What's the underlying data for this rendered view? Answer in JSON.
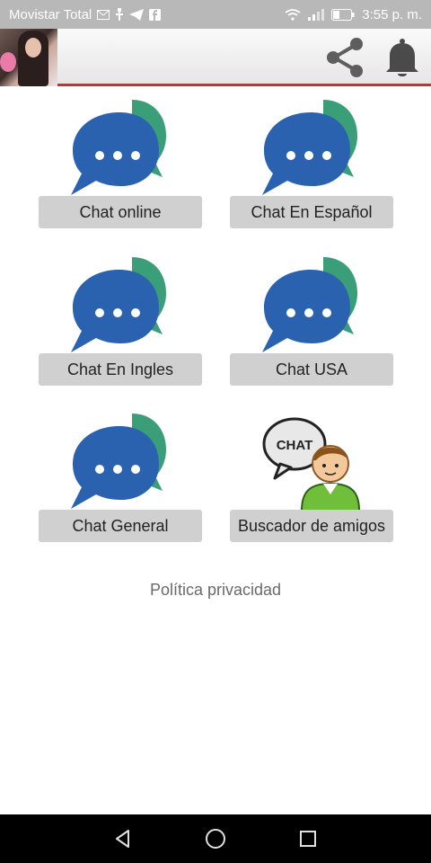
{
  "status_bar": {
    "carrier": "Movistar Total",
    "time": "3:55 p. m.",
    "icons": [
      "mail-icon",
      "usb-icon",
      "telegram-icon",
      "facebook-icon",
      "wifi-icon",
      "signal-icon",
      "battery-icon"
    ]
  },
  "header": {
    "accent_color": "#d12b2b",
    "icons": [
      "avatar",
      "share-icon",
      "bell-icon"
    ]
  },
  "tiles": [
    {
      "label": "Chat online",
      "icon": "chat-bubble-icon"
    },
    {
      "label": "Chat En Español",
      "icon": "chat-bubble-icon"
    },
    {
      "label": "Chat En Ingles",
      "icon": "chat-bubble-icon"
    },
    {
      "label": "Chat USA",
      "icon": "chat-bubble-icon"
    },
    {
      "label": "Chat General",
      "icon": "chat-bubble-icon"
    },
    {
      "label": "Buscador de amigos",
      "icon": "chat-person-icon",
      "icon_text": "CHAT"
    }
  ],
  "privacy_link": "Política privacidad",
  "colors": {
    "bubble_blue": "#2a62b0",
    "bubble_green": "#3a9e78",
    "button_bg": "#d0d0d0"
  },
  "nav_bar": {
    "icons": [
      "back-icon",
      "home-icon",
      "recents-icon"
    ]
  }
}
